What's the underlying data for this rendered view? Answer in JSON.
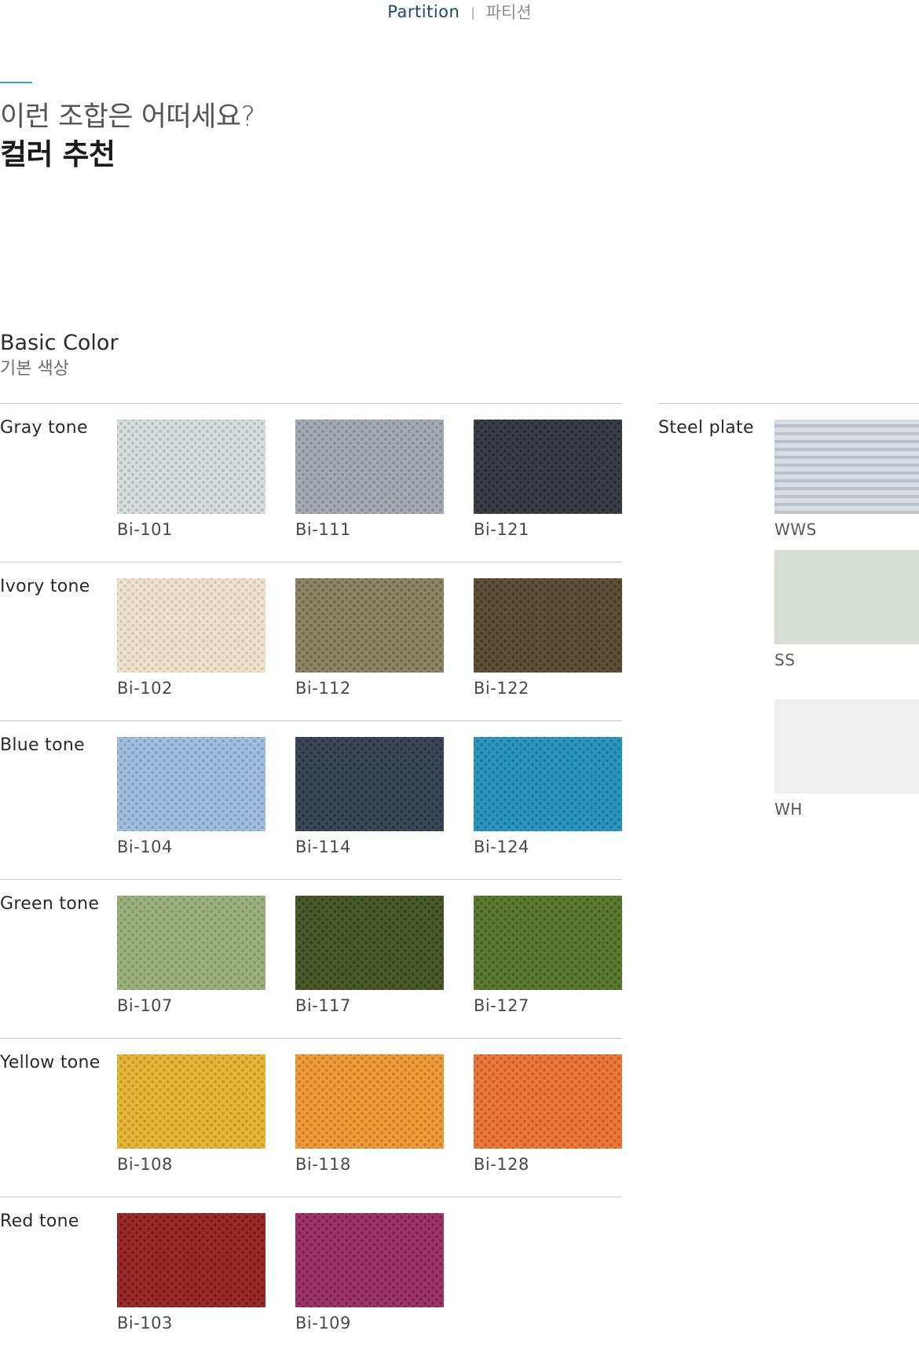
{
  "header": {
    "title_en": "Partition",
    "separator": "|",
    "title_ko": "파티션"
  },
  "headline": {
    "line1": "이런 조합은 어떠세요?",
    "line2": "컬러 추천"
  },
  "section": {
    "title_en": "Basic Color",
    "title_ko": "기본 색상"
  },
  "basic_rows": [
    {
      "label": "Gray tone",
      "swatches": [
        {
          "code": "Bi-101",
          "color": "#d7dcdc",
          "dot": "#b7bebf"
        },
        {
          "code": "Bi-111",
          "color": "#a4a9b2",
          "dot": "#8a8f98"
        },
        {
          "code": "Bi-121",
          "color": "#3b3d45",
          "dot": "#2a2c33"
        }
      ]
    },
    {
      "label": "Ivory tone",
      "swatches": [
        {
          "code": "Bi-102",
          "color": "#ebe1cd",
          "dot": "#d4c8b0"
        },
        {
          "code": "Bi-112",
          "color": "#8c8566",
          "dot": "#6f694e"
        },
        {
          "code": "Bi-122",
          "color": "#5c5039",
          "dot": "#463c29"
        }
      ]
    },
    {
      "label": "Blue tone",
      "swatches": [
        {
          "code": "Bi-104",
          "color": "#a3bedc",
          "dot": "#86a2c4"
        },
        {
          "code": "Bi-114",
          "color": "#3c4858",
          "dot": "#2b3543"
        },
        {
          "code": "Bi-124",
          "color": "#2b97bf",
          "dot": "#1d7ea3"
        }
      ]
    },
    {
      "label": "Green tone",
      "swatches": [
        {
          "code": "Bi-107",
          "color": "#9cb07e",
          "dot": "#849868"
        },
        {
          "code": "Bi-117",
          "color": "#4b5a2c",
          "dot": "#37441d"
        },
        {
          "code": "Bi-127",
          "color": "#5c7a31",
          "dot": "#486222"
        }
      ]
    },
    {
      "label": "Yellow tone",
      "swatches": [
        {
          "code": "Bi-108",
          "color": "#e5b63a",
          "dot": "#cc9a22"
        },
        {
          "code": "Bi-118",
          "color": "#ec9b3d",
          "dot": "#d07f26"
        },
        {
          "code": "Bi-128",
          "color": "#e9793a",
          "dot": "#cc5f25"
        }
      ]
    },
    {
      "label": "Red tone",
      "swatches": [
        {
          "code": "Bi-103",
          "color": "#9b2a2a",
          "dot": "#7d1b1d"
        },
        {
          "code": "Bi-109",
          "color": "#9c3466",
          "dot": "#7f2250"
        }
      ]
    }
  ],
  "steel": {
    "label": "Steel plate",
    "swatches": [
      {
        "code": "WWS",
        "color": "#d9dde1",
        "stripe": "#b9c1ca"
      },
      {
        "code": "SS",
        "color": "#d5ddd5",
        "stripe": "#d5ddd5"
      },
      {
        "code": "WH",
        "color": "#efefef",
        "stripe": "#efefef"
      }
    ]
  }
}
